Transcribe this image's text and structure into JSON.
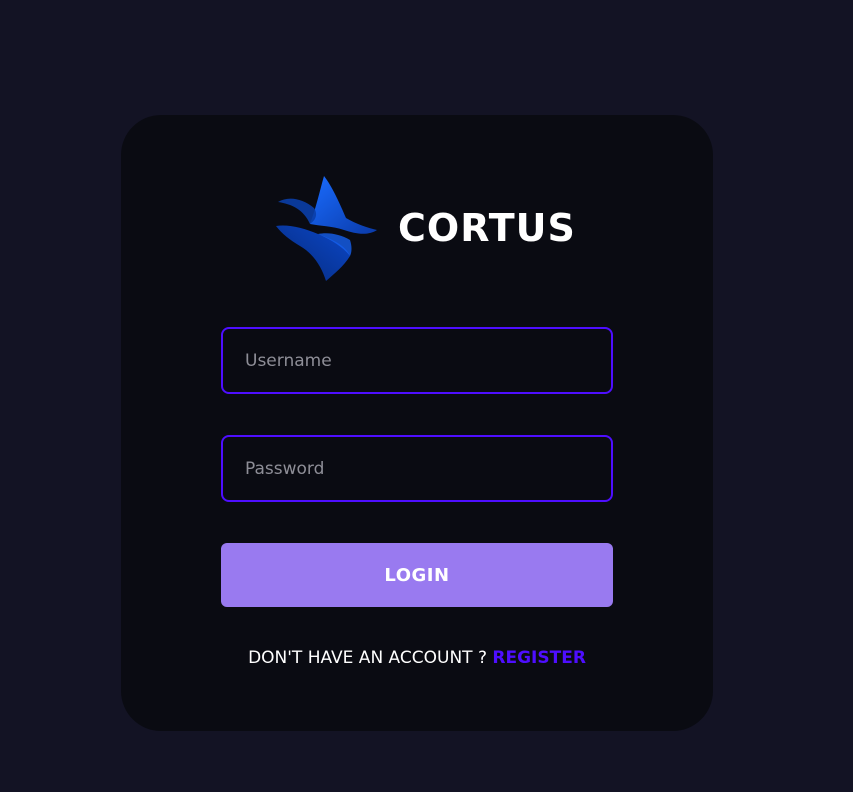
{
  "brand": {
    "name": "CORTUS",
    "logo_icon": "cortus-logo-icon"
  },
  "form": {
    "username_placeholder": "Username",
    "password_placeholder": "Password",
    "login_label": "LOGIN"
  },
  "footer": {
    "prompt": "DON'T HAVE AN ACCOUNT ?",
    "register_label": "REGISTER"
  },
  "colors": {
    "page_background": "#131324",
    "card_background": "#0a0b12",
    "accent_border": "#4e0eff",
    "button_background": "#997af0",
    "register_link": "#4e0eff",
    "logo_blue": "#0a4fd6"
  }
}
